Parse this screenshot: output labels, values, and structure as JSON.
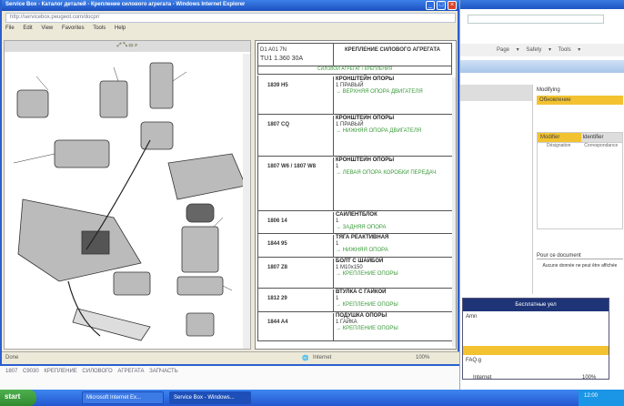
{
  "background_window": {
    "toolbar": "Page ▾  Safety ▾  Tools ▾",
    "right_panel": {
      "label": "Modifying",
      "yellow_bar": "Обновление",
      "tab_active": "Modifier",
      "tab_other": "Identifier",
      "col1": "Désignation",
      "col2": "Correspondance",
      "note_title": "Pour ce document",
      "note_text": "Aucune donnée ne peut être affichée"
    },
    "nav": {
      "header": "Бесплатные уел",
      "item": "Amn",
      "item2": "FAQ.g"
    },
    "status_zone": "Internet",
    "status_zoom": "100%"
  },
  "window": {
    "title": "Service Box - Каталог деталей - Крепление силового агрегата - Windows Internet Explorer",
    "address": "http://servicebox.peugeot.com/docpr/",
    "menu": [
      "File",
      "Edit",
      "View",
      "Favorites",
      "Tools",
      "Help"
    ],
    "diagram_toolbar": "⤢  ⤡  ▭  ⌕",
    "table": {
      "ref_code": "D1 A01 7N",
      "engine": "TU1 1.360 30A",
      "title": "КРЕПЛЕНИЕ СИЛОВОГО АГРЕГАТА",
      "subtitle": "СИЛОВОЙ АГРЕГАТ / КРЕПЛЕНИЯ",
      "rows": [
        {
          "code": "1839 H5",
          "qty": "1",
          "name": "КРОНШТЕЙН ОПОРЫ",
          "detail": "ПРАВЫЙ",
          "note": "→ ВЕРХНЯЯ ОПОРА ДВИГАТЕЛЯ"
        },
        {
          "code": "1807 CQ",
          "qty": "1",
          "name": "КРОНШТЕЙН ОПОРЫ",
          "detail": "ПРАВЫЙ",
          "note": "→ НИЖНЯЯ ОПОРА ДВИГАТЕЛЯ"
        },
        {
          "code": "1807 W6 / 1807 W8",
          "qty": "1",
          "name": "КРОНШТЕЙН ОПОРЫ",
          "detail": "",
          "note": "→ ЛЕВАЯ ОПОРА КОРОБКИ ПЕРЕДАЧ"
        },
        {
          "code": "1806 14",
          "qty": "1",
          "name": "САЙЛЕНТБЛОК",
          "detail": "",
          "note": "→ ЗАДНЯЯ ОПОРА"
        },
        {
          "code": "1844 95",
          "qty": "1",
          "name": "ТЯГА РЕАКТИВНАЯ",
          "detail": "",
          "note": "→ НИЖНЯЯ ОПОРА"
        },
        {
          "code": "1807 Z8",
          "qty": "1",
          "name": "БОЛТ С ШАЙБОЙ",
          "detail": "M10x150",
          "note": "→ КРЕПЛЕНИЕ ОПОРЫ"
        },
        {
          "code": "1812 29",
          "qty": "1",
          "name": "ВТУЛКА С ГАЙКОЙ",
          "detail": "",
          "note": "→ КРЕПЛЕНИЕ ОПОРЫ"
        },
        {
          "code": "1844 A4",
          "qty": "1",
          "name": "ПОДУШКА ОПОРЫ",
          "detail": "ГАЙКА",
          "note": "→ КРЕПЛЕНИЕ ОПОРЫ"
        }
      ]
    },
    "status_left": "Done",
    "status_zone": "Internet",
    "status_zoom": "100%"
  },
  "behind_row": "1807 C9030    КРЕПЛЕНИЕ СИЛОВОГО АГРЕГАТА    ЗАПЧАСТЬ",
  "taskbar": {
    "start": "start",
    "tasks": [
      "Microsoft Internet Ex...",
      "Service Box - Windows..."
    ],
    "clock": "12:00"
  }
}
